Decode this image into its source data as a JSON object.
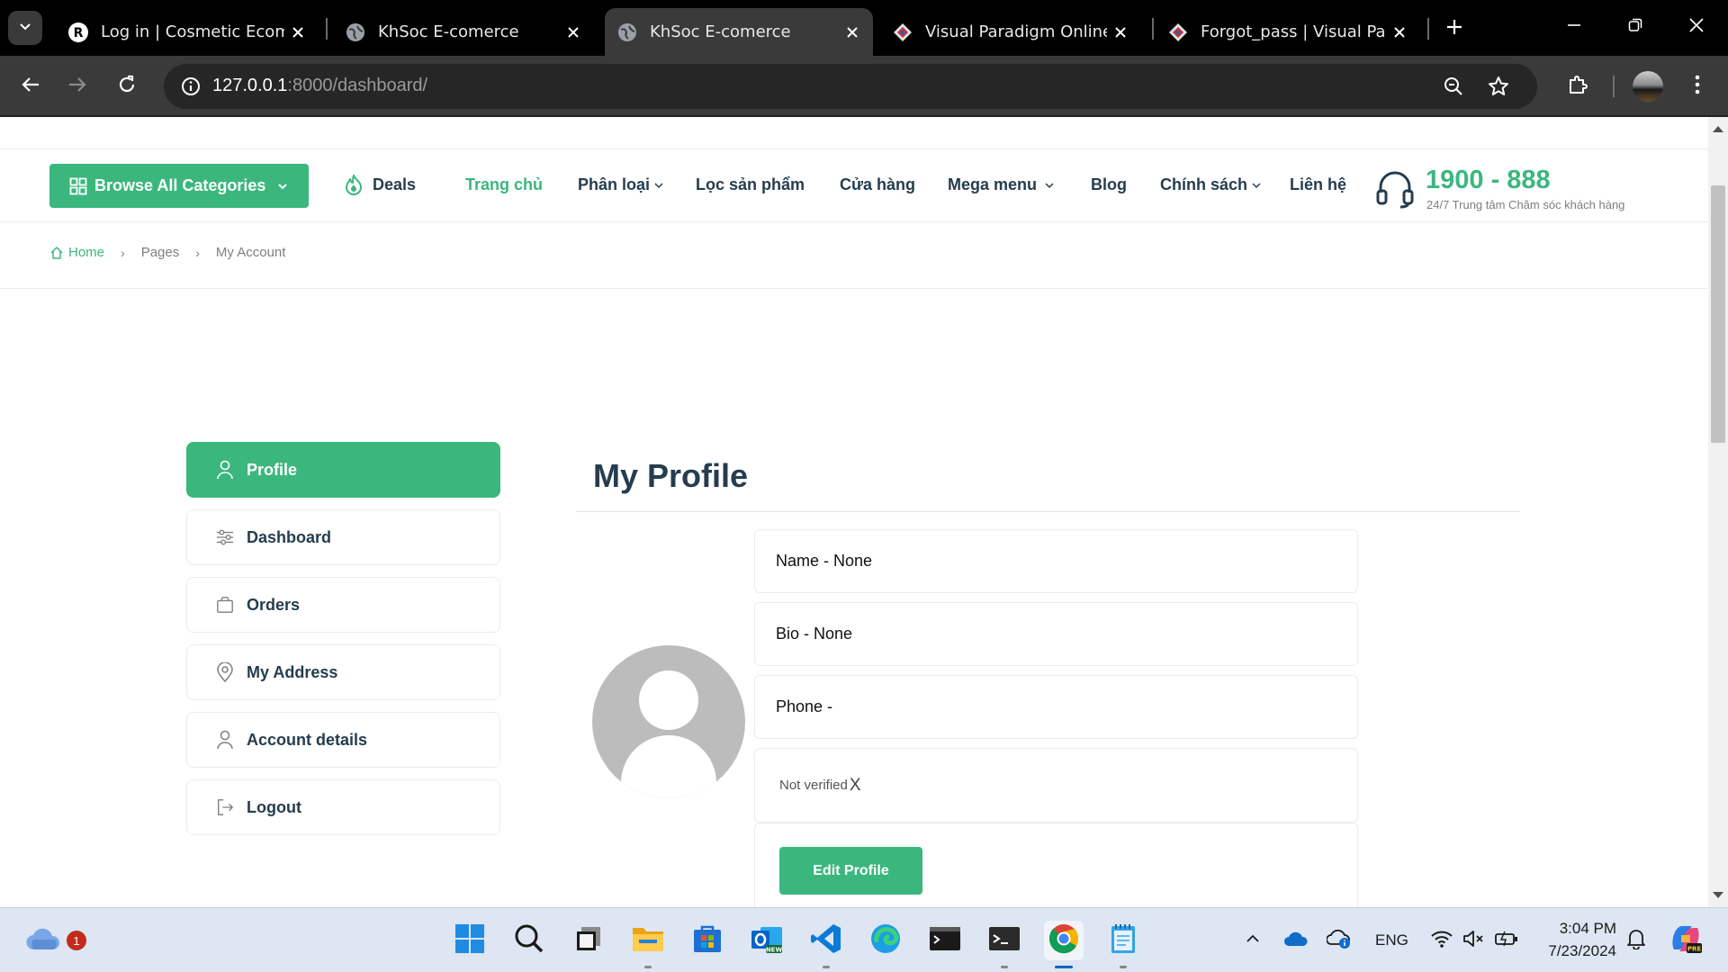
{
  "browser": {
    "tabs": [
      {
        "title": "Log in | Cosmetic Ecomm",
        "icon": "site-r-icon"
      },
      {
        "title": "KhSoc E-comerce",
        "icon": "globe-icon"
      },
      {
        "title": "KhSoc E-comerce",
        "icon": "globe-icon",
        "active": true
      },
      {
        "title": "Visual Paradigm Online",
        "icon": "visual-paradigm-icon"
      },
      {
        "title": "Forgot_pass | Visual Parad",
        "icon": "visual-paradigm-icon"
      }
    ],
    "url_host": "127.0.0.1",
    "url_rest": ":8000/dashboard/"
  },
  "header": {
    "browse_label": "Browse All Categories",
    "deals_label": "Deals",
    "nav": [
      "Trang chủ",
      "Phân loại",
      "Lọc sản phẩm",
      "Cửa hàng",
      "Mega menu",
      "Blog",
      "Chính sách",
      "Liên hệ"
    ],
    "hotline_number": "1900 - 888",
    "hotline_sub": "24/7 Trung tâm Chăm sóc khách hàng"
  },
  "breadcrumb": {
    "home": "Home",
    "pages": "Pages",
    "current": "My Account",
    "separator": "›"
  },
  "sidebar": {
    "items": [
      {
        "label": "Profile",
        "icon": "user-icon",
        "active": true
      },
      {
        "label": "Dashboard",
        "icon": "sliders-icon"
      },
      {
        "label": "Orders",
        "icon": "bag-icon"
      },
      {
        "label": "My Address",
        "icon": "map-pin-icon"
      },
      {
        "label": "Account details",
        "icon": "user-icon"
      },
      {
        "label": "Logout",
        "icon": "logout-icon"
      }
    ]
  },
  "profile": {
    "title": "My Profile",
    "name": "Name - None",
    "bio": "Bio - None",
    "phone": "Phone -",
    "verified": "Not verified",
    "verified_mark": "X",
    "edit_label": "Edit Profile"
  },
  "taskbar": {
    "weather_badge": "1",
    "lang": "ENG",
    "time": "3:04 PM",
    "date": "7/23/2024"
  },
  "colors": {
    "accent": "#3bb77e",
    "heading": "#253d4e",
    "muted": "#7e7e7e"
  }
}
